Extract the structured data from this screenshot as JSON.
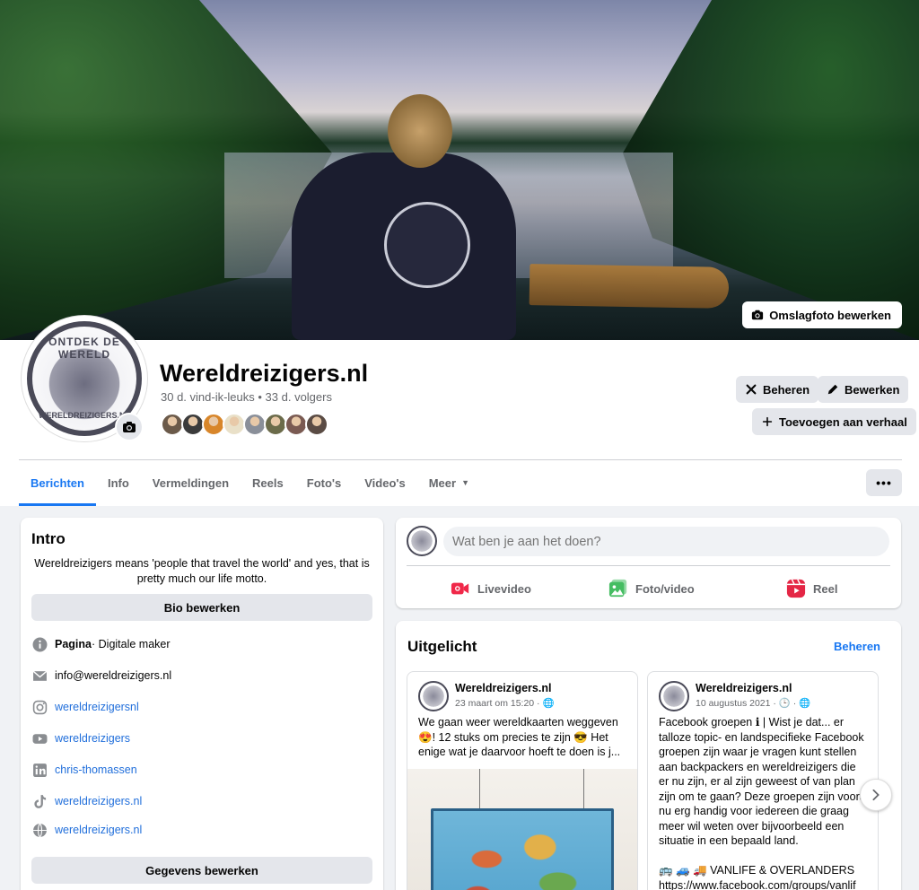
{
  "cover": {
    "edit_label": "Omslagfoto bewerken"
  },
  "profile": {
    "logo_top": "ONTDEK DE WERELD",
    "logo_bottom": "WERELDREIZIGERS.NL",
    "name": "Wereldreizigers.nl",
    "stats": "30 d. vind-ik-leuks • 33 d. volgers",
    "friend_colors": [
      "#6b5a4a",
      "#3b3b3b",
      "#d8862a",
      "#e9e0c8",
      "#8a8f99",
      "#6b6b4a",
      "#7a5a52",
      "#5a4b44"
    ]
  },
  "actions": {
    "manage": "Beheren",
    "edit": "Bewerken",
    "add_story": "Toevoegen aan verhaal",
    "more": "•••"
  },
  "tabs": [
    {
      "label": "Berichten",
      "active": true
    },
    {
      "label": "Info"
    },
    {
      "label": "Vermeldingen"
    },
    {
      "label": "Reels"
    },
    {
      "label": "Foto's"
    },
    {
      "label": "Video's"
    },
    {
      "label": "Meer",
      "caret": "▼"
    }
  ],
  "intro": {
    "title": "Intro",
    "bio": "Wereldreizigers means 'people that travel the world' and yes, that is pretty much our life motto.",
    "bio_button": "Bio bewerken",
    "page_label": "Pagina",
    "page_type": " · Digitale maker",
    "email": "info@wereldreizigers.nl",
    "instagram": "wereldreizigersnl",
    "youtube": "wereldreizigers",
    "linkedin": "chris-thomassen",
    "tiktok": "wereldreizigers.nl",
    "website": "wereldreizigers.nl",
    "details_button": "Gegevens bewerken"
  },
  "composer": {
    "placeholder": "Wat ben je aan het doen?",
    "live": "Livevideo",
    "photo": "Foto/video",
    "reel": "Reel"
  },
  "featured": {
    "title": "Uitgelicht",
    "manage": "Beheren",
    "posts": [
      {
        "author": "Wereldreizigers.nl",
        "date": "23 maart om 15:20 · 🌐",
        "text": "We gaan weer wereldkaarten weggeven 😍! 12 stuks om precies te zijn 😎 Het enige wat je daarvoor hoeft te doen is j..."
      },
      {
        "author": "Wereldreizigers.nl",
        "date": "10 augustus 2021 · 🕒 · 🌐",
        "text": "Facebook groepen ℹ | Wist je dat... er talloze topic- en landspecifieke Facebook groepen zijn waar je vragen kunt stellen aan backpackers en wereldreizigers die er nu zijn, er al zijn geweest of van plan zijn om te gaan? Deze groepen zijn vooral nu erg handig voor iedereen die graag meer wil weten over bijvoorbeeld een situatie in een bepaald land.",
        "text2": "🚌 🚙 🚚 VANLIFE & OVERLANDERS",
        "text3": "https://www.facebook.com/groups/vanlif"
      }
    ]
  }
}
